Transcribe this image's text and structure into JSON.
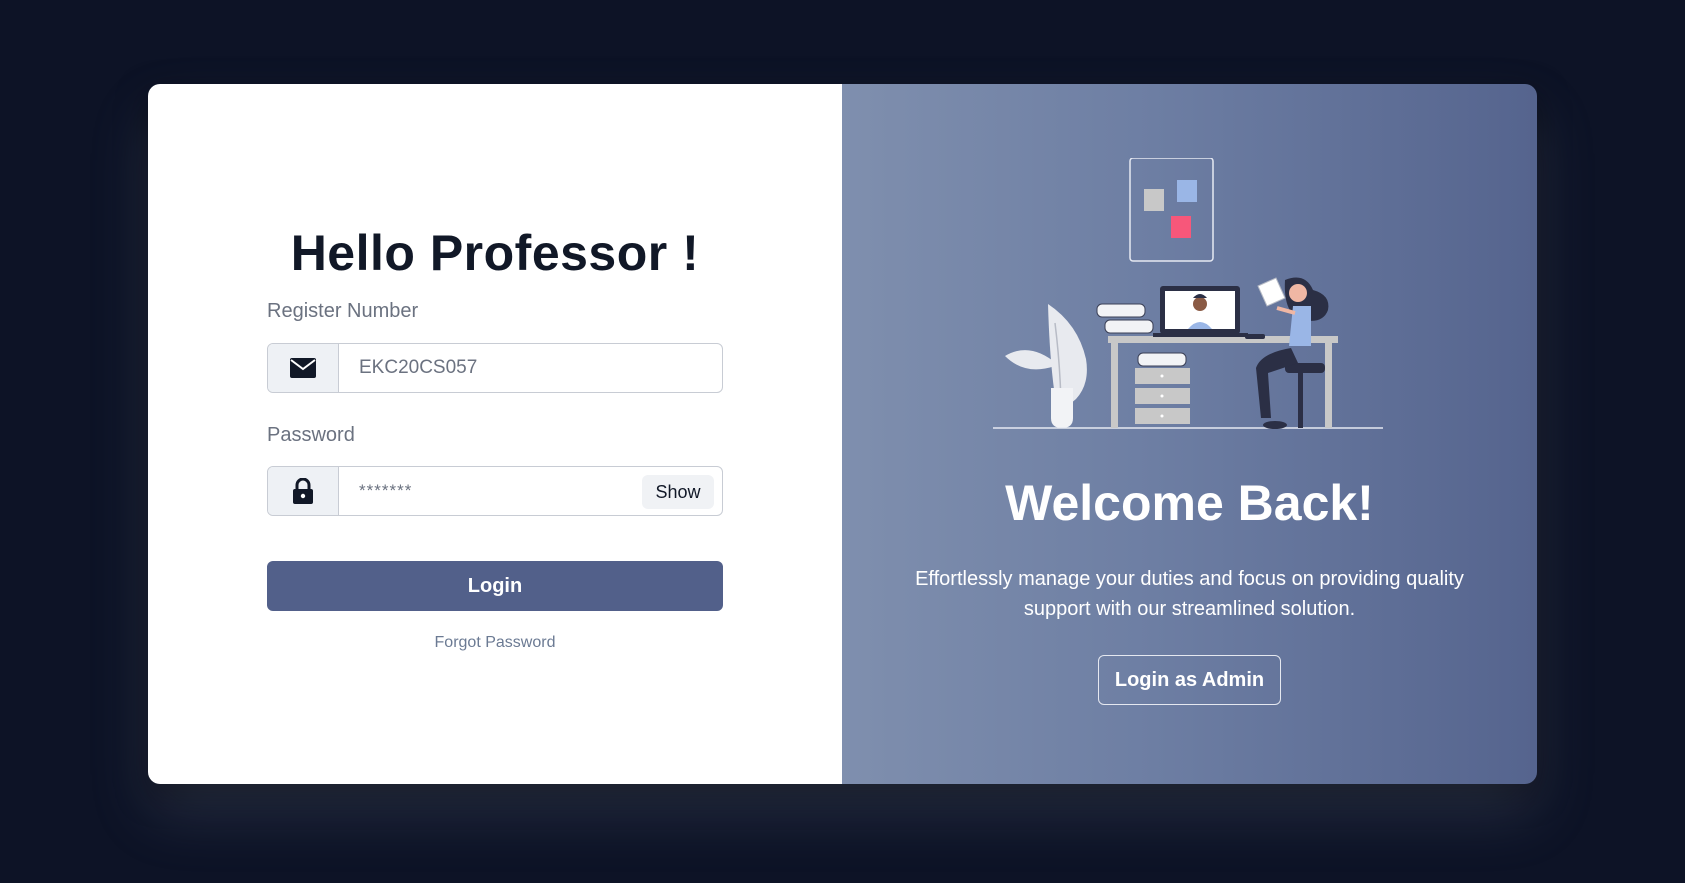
{
  "login": {
    "title": "Hello Professor !",
    "register_label": "Register Number",
    "register_value": "EKC20CS057",
    "password_label": "Password",
    "password_value": "*******",
    "show_label": "Show",
    "login_label": "Login",
    "forgot_label": "Forgot Password"
  },
  "welcome": {
    "title": "Welcome Back!",
    "description": "Effortlessly manage your duties and focus on providing quality support with our streamlined solution.",
    "admin_label": "Login as Admin"
  },
  "icons": {
    "register": "envelope-icon",
    "password": "lock-icon"
  },
  "colors": {
    "background": "#0d1326",
    "primary_button": "#52608a",
    "accent_pink": "#f7577a",
    "accent_blue": "#9ab6e6"
  }
}
